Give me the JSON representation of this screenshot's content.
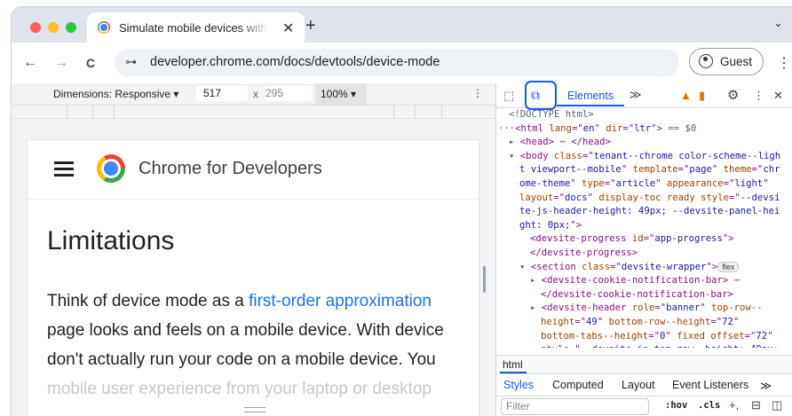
{
  "window": {
    "traffic_lights": [
      "#ff5f57",
      "#febc2e",
      "#28c840"
    ],
    "tab_title": "Simulate mobile devices with",
    "new_tab_glyph": "+",
    "tab_close_glyph": "✕"
  },
  "toolbar": {
    "back_glyph": "←",
    "forward_glyph": "→",
    "reload_glyph": "C",
    "site_info_glyph": "⊶",
    "url": "developer.chrome.com/docs/devtools/device-mode",
    "profile_label": "Guest",
    "menu_glyph": "⋮"
  },
  "device_toolbar": {
    "dimensions": "Dimensions: Responsive ▾",
    "width": "517",
    "times": "x",
    "height": "295",
    "zoom": "100% ▾",
    "more": "⋮"
  },
  "page": {
    "brand": "Chrome for Developers",
    "heading": "Limitations",
    "para_line1_pre": "Think of device mode as a ",
    "para_line1_link": "first-order approximation",
    "para_line2": "page looks and feels on a mobile device. With device",
    "para_line3": "don't actually run your code on a mobile device. You",
    "para_line4": "mobile user experience from your laptop or desktop"
  },
  "devtools": {
    "tab_elements": "Elements",
    "more_tabs": "≫",
    "tree": [
      {
        "indent": 1,
        "parts": [
          [
            "cm",
            "<!DOCTYPE html>"
          ]
        ]
      },
      {
        "indent": 0,
        "parts": [
          [
            "cm",
            "···"
          ],
          [
            "tg",
            "<html "
          ],
          [
            "an",
            "lang"
          ],
          [
            "tg",
            "=\""
          ],
          [
            "av",
            "en"
          ],
          [
            "tg",
            "\" "
          ],
          [
            "an",
            "dir"
          ],
          [
            "tg",
            "=\""
          ],
          [
            "av",
            "ltr"
          ],
          [
            "tg",
            "\">"
          ],
          [
            "cm",
            " == $0"
          ]
        ]
      },
      {
        "indent": 1,
        "parts": [
          [
            "cm",
            "▸ "
          ],
          [
            "tg",
            "<head>"
          ],
          [
            "cm",
            " ⋯ "
          ],
          [
            "tg",
            "</head>"
          ]
        ]
      },
      {
        "indent": 1,
        "parts": [
          [
            "cm",
            "▾ "
          ],
          [
            "tg",
            "<body "
          ],
          [
            "an",
            "class"
          ],
          [
            "tg",
            "=\""
          ],
          [
            "av",
            "tenant--chrome color-scheme--ligh"
          ]
        ]
      },
      {
        "indent": 2,
        "parts": [
          [
            "av",
            "t viewport--mobile"
          ],
          [
            "tg",
            "\" "
          ],
          [
            "an",
            "template"
          ],
          [
            "tg",
            "=\""
          ],
          [
            "av",
            "page"
          ],
          [
            "tg",
            "\" "
          ],
          [
            "an",
            "theme"
          ],
          [
            "tg",
            "=\""
          ],
          [
            "av",
            "chr"
          ]
        ]
      },
      {
        "indent": 2,
        "parts": [
          [
            "av",
            "ome-theme"
          ],
          [
            "tg",
            "\" "
          ],
          [
            "an",
            "type"
          ],
          [
            "tg",
            "=\""
          ],
          [
            "av",
            "article"
          ],
          [
            "tg",
            "\" "
          ],
          [
            "an",
            "appearance"
          ],
          [
            "tg",
            "=\""
          ],
          [
            "av",
            "light"
          ],
          [
            "tg",
            "\""
          ]
        ]
      },
      {
        "indent": 2,
        "parts": [
          [
            "an",
            "layout"
          ],
          [
            "tg",
            "=\""
          ],
          [
            "av",
            "docs"
          ],
          [
            "tg",
            "\" "
          ],
          [
            "an",
            "display-toc ready style"
          ],
          [
            "tg",
            "=\""
          ],
          [
            "av",
            "--devsi"
          ]
        ]
      },
      {
        "indent": 2,
        "parts": [
          [
            "av",
            "te-js-header-height: 49px; --devsite-panel-hei"
          ]
        ]
      },
      {
        "indent": 2,
        "parts": [
          [
            "av",
            "ght: 0px;"
          ],
          [
            "tg",
            "\">"
          ]
        ]
      },
      {
        "indent": 3,
        "parts": [
          [
            "tg",
            "<devsite-progress "
          ],
          [
            "an",
            "id"
          ],
          [
            "tg",
            "=\""
          ],
          [
            "av",
            "app-progress"
          ],
          [
            "tg",
            "\">"
          ]
        ]
      },
      {
        "indent": 3,
        "parts": [
          [
            "tg",
            "</devsite-progress>"
          ]
        ]
      },
      {
        "indent": 2,
        "parts": [
          [
            "cm",
            "▾ "
          ],
          [
            "tg",
            "<section "
          ],
          [
            "an",
            "class"
          ],
          [
            "tg",
            "=\""
          ],
          [
            "av",
            "devsite-wrapper"
          ],
          [
            "tg",
            "\">"
          ],
          [
            "pill",
            "flex"
          ]
        ]
      },
      {
        "indent": 3,
        "parts": [
          [
            "cm",
            "▸ "
          ],
          [
            "tg",
            "<devsite-cookie-notification-bar>"
          ],
          [
            "cm",
            " ⋯"
          ]
        ]
      },
      {
        "indent": 4,
        "parts": [
          [
            "tg",
            "</devsite-cookie-notification-bar>"
          ]
        ]
      },
      {
        "indent": 3,
        "parts": [
          [
            "cm",
            "▸ "
          ],
          [
            "tg",
            "<devsite-header "
          ],
          [
            "an",
            "role"
          ],
          [
            "tg",
            "=\""
          ],
          [
            "av",
            "banner"
          ],
          [
            "tg",
            "\" "
          ],
          [
            "an",
            "top-row--"
          ]
        ]
      },
      {
        "indent": 4,
        "parts": [
          [
            "an",
            "height"
          ],
          [
            "tg",
            "=\""
          ],
          [
            "av",
            "49"
          ],
          [
            "tg",
            "\" "
          ],
          [
            "an",
            "bottom-row--height"
          ],
          [
            "tg",
            "=\""
          ],
          [
            "av",
            "72"
          ],
          [
            "tg",
            "\""
          ]
        ]
      },
      {
        "indent": 4,
        "parts": [
          [
            "an",
            "bottom-tabs--height"
          ],
          [
            "tg",
            "=\""
          ],
          [
            "av",
            "0"
          ],
          [
            "tg",
            "\" "
          ],
          [
            "an",
            "fixed offset"
          ],
          [
            "tg",
            "=\""
          ],
          [
            "av",
            "72"
          ],
          [
            "tg",
            "\""
          ]
        ]
      },
      {
        "indent": 4,
        "parts": [
          [
            "an",
            "style"
          ],
          [
            "tg",
            "=\""
          ],
          [
            "av",
            "--devsite-js-top-row--height: 49px;"
          ]
        ]
      }
    ],
    "breadcrumb": "html",
    "styles_tabs": [
      "Styles",
      "Computed",
      "Layout",
      "Event Listeners",
      "≫"
    ],
    "filter_placeholder": "Filter",
    "hov": ":hov",
    "cls": ".cls"
  }
}
